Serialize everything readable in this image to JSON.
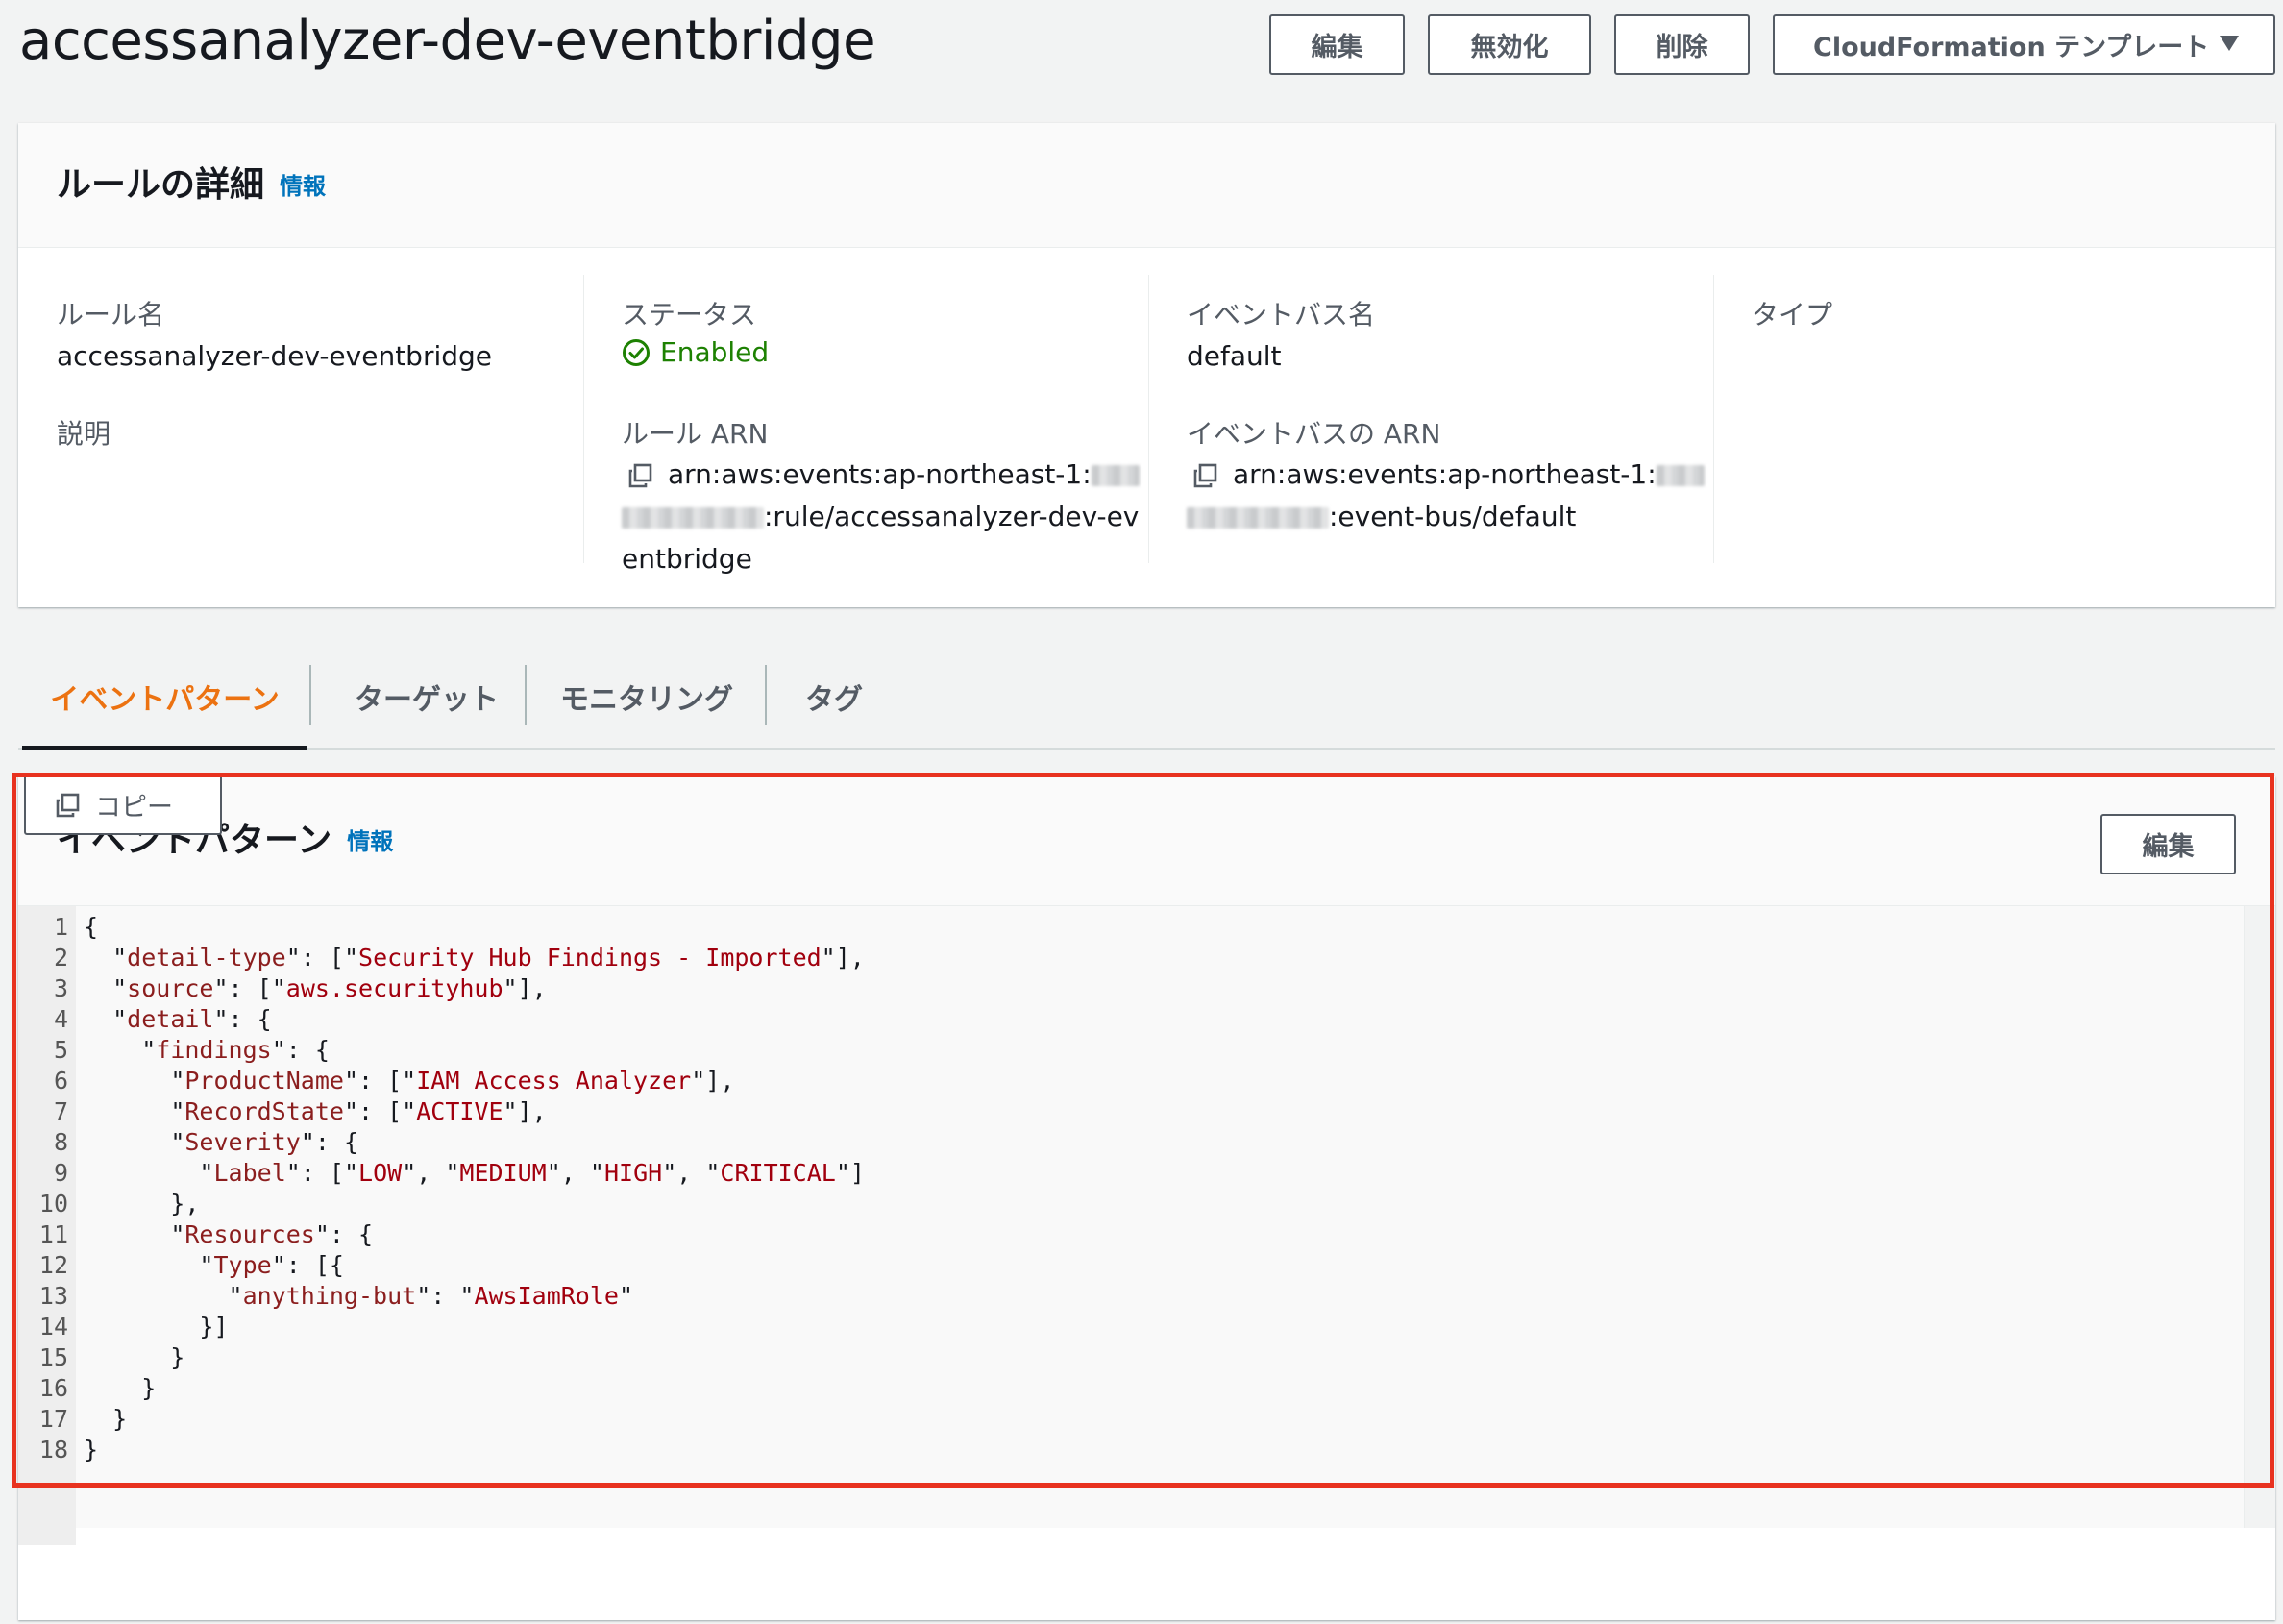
{
  "header": {
    "title": "accessanalyzer-dev-eventbridge",
    "buttons": {
      "edit": "編集",
      "disable": "無効化",
      "delete": "削除",
      "cloudformation": "CloudFormation テンプレート"
    }
  },
  "details": {
    "title": "ルールの詳細",
    "info": "情報",
    "rule_name_label": "ルール名",
    "rule_name": "accessanalyzer-dev-eventbridge",
    "description_label": "説明",
    "status_label": "ステータス",
    "status": "Enabled",
    "rule_arn_label": "ルール ARN",
    "rule_arn": {
      "prefix": "arn:aws:events:ap-northeast-1:",
      "suffix": ":rule/accessanalyzer-dev-ev",
      "tail": "entbridge"
    },
    "event_bus_name_label": "イベントバス名",
    "event_bus_name": "default",
    "event_bus_arn_label": "イベントバスの ARN",
    "event_bus_arn": {
      "prefix": "arn:aws:events:ap-northeast-1:",
      "suffix": ":event-bus/default"
    },
    "type_label": "タイプ"
  },
  "tabs": [
    {
      "label": "イベントパターン",
      "active": true
    },
    {
      "label": "ターゲット",
      "active": false
    },
    {
      "label": "モニタリング",
      "active": false
    },
    {
      "label": "タグ",
      "active": false
    }
  ],
  "pattern": {
    "title": "イベントパターン",
    "info": "情報",
    "edit": "編集",
    "copy": "コピー",
    "line_numbers": [
      "1",
      "2",
      "3",
      "4",
      "5",
      "6",
      "7",
      "8",
      "9",
      "10",
      "11",
      "12",
      "13",
      "14",
      "15",
      "16",
      "17",
      "18"
    ],
    "lines": [
      "{",
      "  \"detail-type\": [\"Security Hub Findings - Imported\"],",
      "  \"source\": [\"aws.securityhub\"],",
      "  \"detail\": {",
      "    \"findings\": {",
      "      \"ProductName\": [\"IAM Access Analyzer\"],",
      "      \"RecordState\": [\"ACTIVE\"],",
      "      \"Severity\": {",
      "        \"Label\": [\"LOW\", \"MEDIUM\", \"HIGH\", \"CRITICAL\"]",
      "      },",
      "      \"Resources\": {",
      "        \"Type\": [{",
      "          \"anything-but\": \"AwsIamRole\"",
      "        }]",
      "      }",
      "    }",
      "  }",
      "}"
    ]
  },
  "colors": {
    "accent_tab": "#ec7211",
    "link": "#0073bb",
    "status_ok": "#1d8102",
    "highlight_box": "#e8321f",
    "json_string": "#a1000e"
  },
  "icons": {
    "status": "check-circle-icon",
    "copy": "copy-icon",
    "dropdown": "caret-down-icon"
  }
}
